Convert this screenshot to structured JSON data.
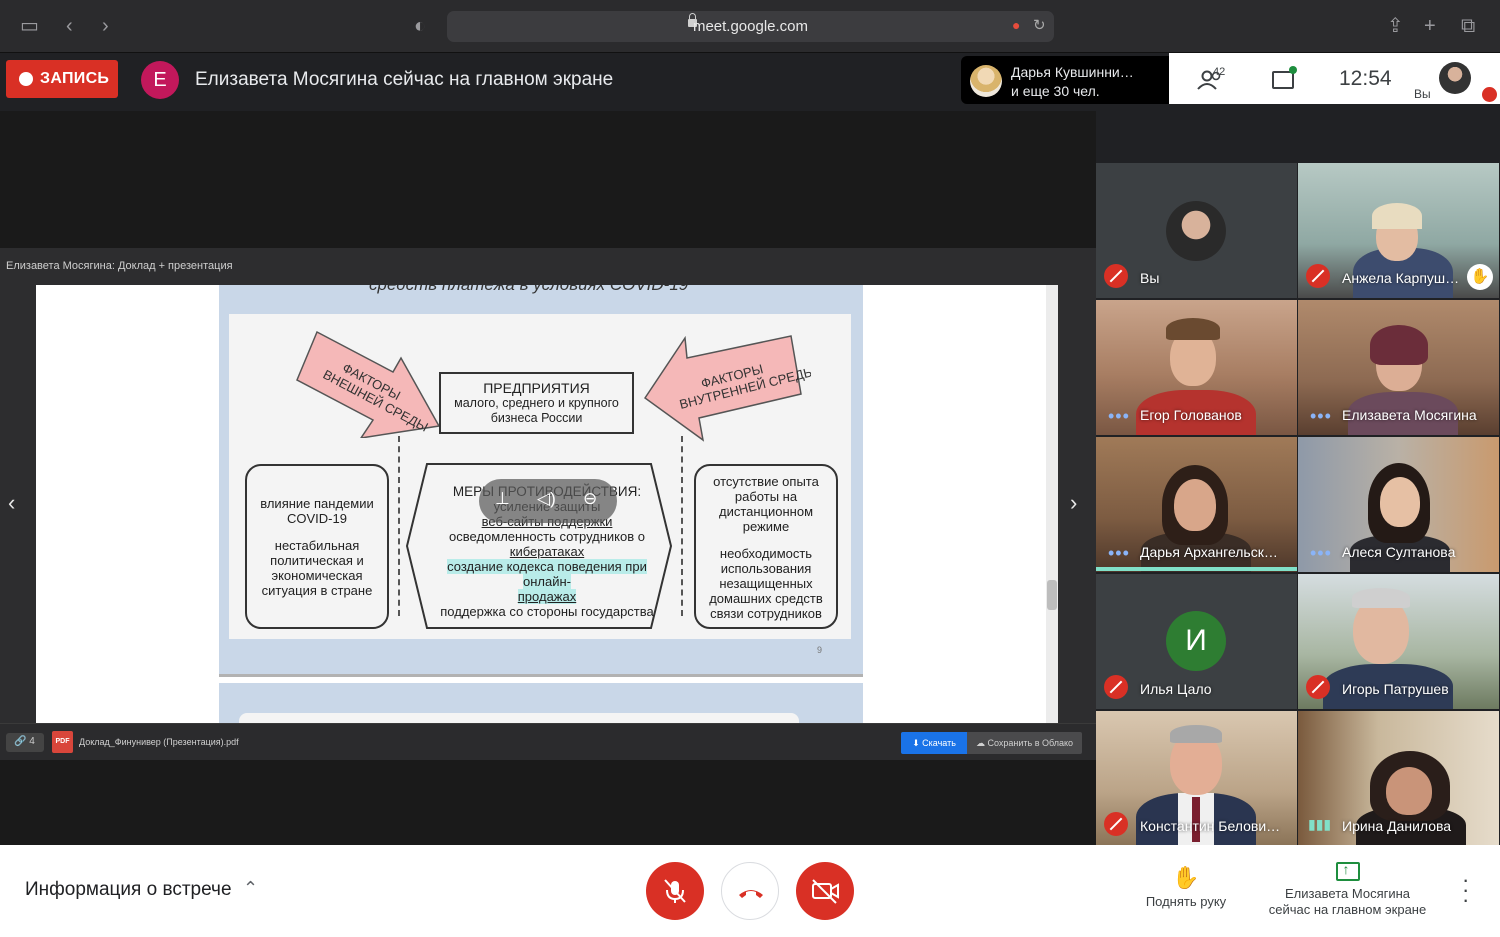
{
  "browser": {
    "url": "meet.google.com"
  },
  "top": {
    "record_label": "ЗАПИСЬ",
    "presenter_initial": "Е",
    "presenter_banner": "Елизавета Мосягина сейчас на главном экране",
    "speaker_line1": "Дарья Кувшинни…",
    "speaker_line2": "и еще 30 чел.",
    "people_count": "42",
    "clock": "12:54",
    "me_label": "Вы"
  },
  "presentation": {
    "viewer_title": "Елизавета Мосягина: Доклад + презентация",
    "slide_top_text": "средств платежа в условиях COVID-19",
    "left_arrow": "ФАКТОРЫ ВНЕШНЕЙ СРЕДЫ",
    "right_arrow": "ФАКТОРЫ ВНУТРЕННЕЙ СРЕДЫ",
    "enterprise_title": "ПРЕДПРИЯТИЯ",
    "enterprise_sub": "малого, среднего и крупного бизнеса России",
    "left_box_1": "влияние пандемии COVID-19",
    "left_box_2": "нестабильная политическая и экономическая ситуация в стране",
    "mid_title": "МЕРЫ ПРОТИВОДЕЙСТВИЯ:",
    "mid_1a": "усиление защиты",
    "mid_1b": "веб-сайты поддержки",
    "mid_2a": "осведомленность сотрудников о",
    "mid_2b": "кибератаках",
    "mid_3a": "создание кодекса поведения при онлайн-",
    "mid_3b": "продажах",
    "mid_4": "поддержка со стороны государства",
    "right_box_1": "отсутствие опыта работы на дистанционном режиме",
    "right_box_2": "необходимость использования незащищенных домашних средств связи сотрудников",
    "slide_num": "9",
    "attach_count": "4",
    "pdf_label": "PDF",
    "file_name": "Доклад_Финунивер (Презентация).pdf",
    "download_label": "Скачать",
    "cloud_label": "Сохранить в Облако"
  },
  "participants": [
    {
      "name": "Вы",
      "status": "muted"
    },
    {
      "name": "Анжела Карпуш…",
      "status": "muted",
      "hand": true
    },
    {
      "name": "Егор Голованов",
      "status": "dots"
    },
    {
      "name": "Елизавета Мосягина",
      "status": "dots"
    },
    {
      "name": "Дарья Архангельск…",
      "status": "dots",
      "active": true
    },
    {
      "name": "Алеся Султанова",
      "status": "dots"
    },
    {
      "name": "Илья Цало",
      "status": "muted",
      "initial": "И",
      "avatar_color": "#2e7d32"
    },
    {
      "name": "Игорь Патрушев",
      "status": "muted"
    },
    {
      "name": "Константин Белови…",
      "status": "muted"
    },
    {
      "name": "Ирина Данилова",
      "status": "speaking"
    }
  ],
  "bottom": {
    "meeting_info": "Информация о встрече",
    "raise_hand": "Поднять руку",
    "present_line1": "Елизавета Мосягина",
    "present_line2": "сейчас на главном экране"
  },
  "colors": {
    "accent_red": "#d93025",
    "meet_dark": "#202124",
    "highlight": "#b9ece9",
    "active_speaker": "#81e0c8"
  }
}
